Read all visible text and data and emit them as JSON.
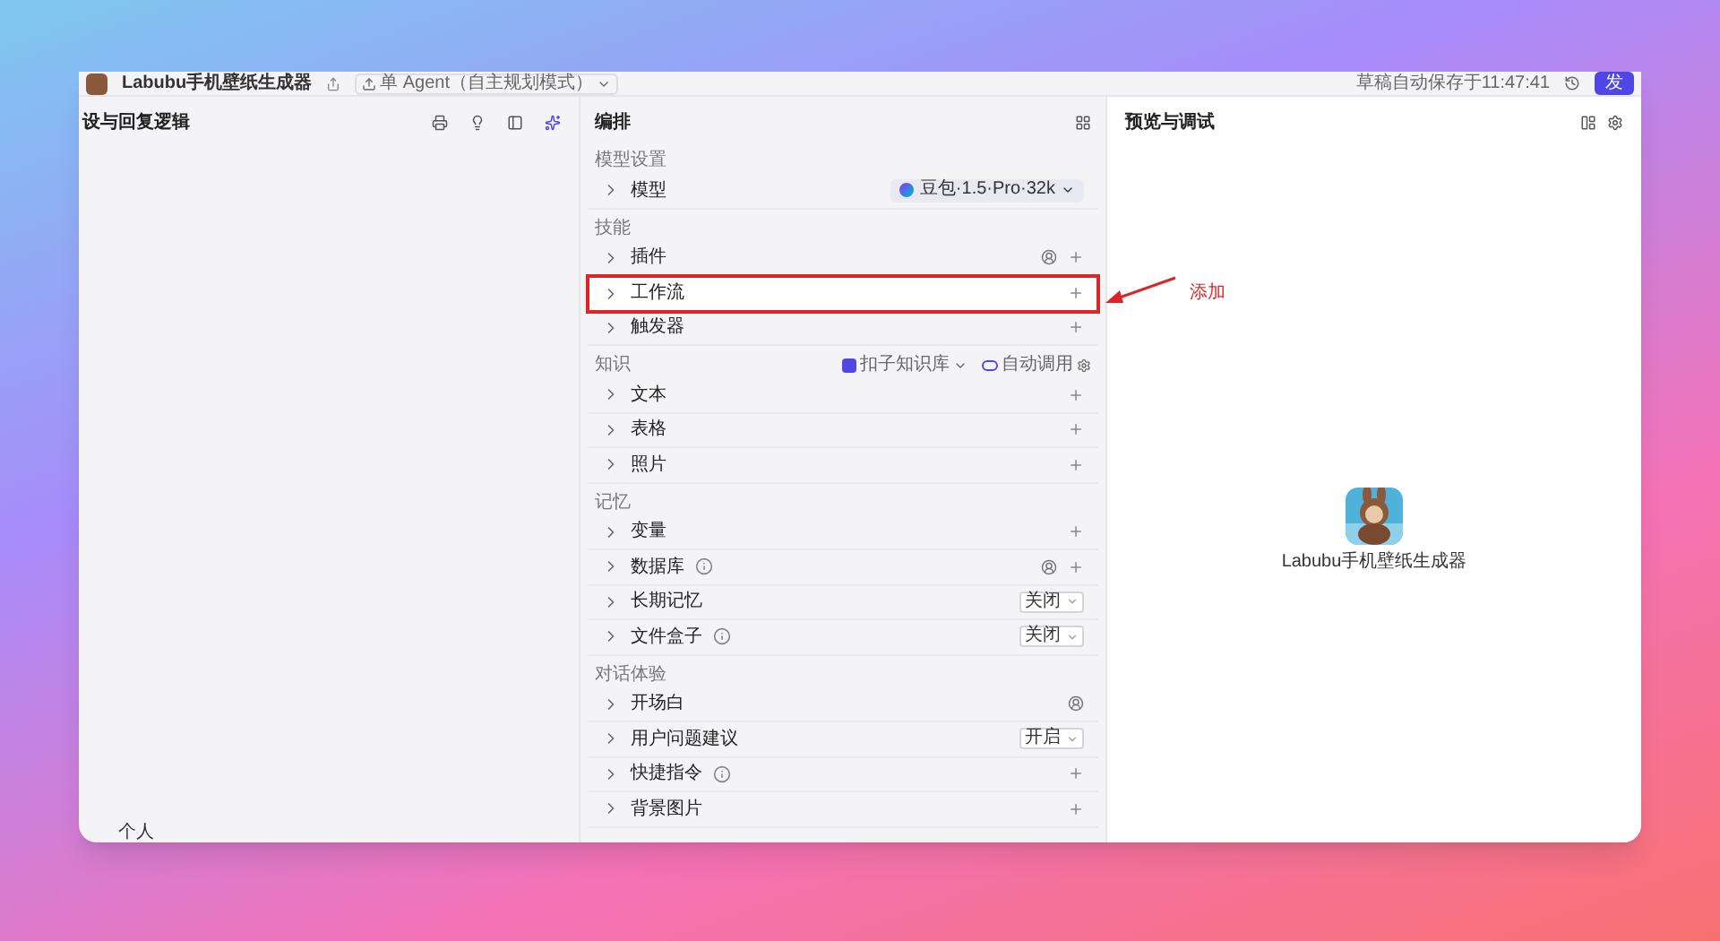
{
  "top_bar": {
    "app_name": "Labubu手机壁纸生成器",
    "mode": "单 Agent（自主规划模式）",
    "save_status": "草稿自动保存于11:47:41",
    "publish": "发"
  },
  "left_panel": {
    "title": "设与回复逻辑",
    "tabs": [
      {
        "label": "个人",
        "selected": false
      }
    ]
  },
  "middle_panel": {
    "title": "编排",
    "sections": [
      {
        "title": "模型设置",
        "rows": [
          {
            "label": "模型",
            "kind": "model",
            "value": "豆包·1.5·Pro·32k",
            "info": false,
            "auto": false,
            "add": false,
            "highlighted": false
          }
        ]
      },
      {
        "title": "技能",
        "rows": [
          {
            "label": "插件",
            "kind": "plain",
            "info": false,
            "auto": true,
            "add": true,
            "highlighted": false
          },
          {
            "label": "工作流",
            "kind": "plain",
            "info": false,
            "auto": false,
            "add": true,
            "highlighted": true
          },
          {
            "label": "触发器",
            "kind": "plain",
            "info": false,
            "auto": false,
            "add": true,
            "highlighted": false
          }
        ]
      },
      {
        "title": "知识",
        "knowledge_base": "扣子知识库",
        "call_mode": "自动调用",
        "rows": [
          {
            "label": "文本",
            "kind": "plain",
            "info": false,
            "auto": false,
            "add": true,
            "highlighted": false
          },
          {
            "label": "表格",
            "kind": "plain",
            "info": false,
            "auto": false,
            "add": true,
            "highlighted": false
          },
          {
            "label": "照片",
            "kind": "plain",
            "info": false,
            "auto": false,
            "add": true,
            "highlighted": false
          }
        ]
      },
      {
        "title": "记忆",
        "rows": [
          {
            "label": "变量",
            "kind": "plain",
            "info": false,
            "auto": false,
            "add": true,
            "highlighted": false
          },
          {
            "label": "数据库",
            "kind": "plain",
            "info": true,
            "auto": true,
            "add": true,
            "highlighted": false
          },
          {
            "label": "长期记忆",
            "kind": "select",
            "value": "关闭",
            "info": false,
            "auto": false,
            "add": false,
            "highlighted": false
          },
          {
            "label": "文件盒子",
            "kind": "select",
            "value": "关闭",
            "info": true,
            "auto": false,
            "add": false,
            "highlighted": false
          }
        ]
      },
      {
        "title": "对话体验",
        "rows": [
          {
            "label": "开场白",
            "kind": "plain",
            "info": false,
            "auto": true,
            "add": false,
            "highlighted": false
          },
          {
            "label": "用户问题建议",
            "kind": "select",
            "value": "开启",
            "info": false,
            "auto": false,
            "add": false,
            "highlighted": false
          },
          {
            "label": "快捷指令",
            "kind": "plain",
            "info": true,
            "auto": false,
            "add": true,
            "highlighted": false
          },
          {
            "label": "背景图片",
            "kind": "plain",
            "info": false,
            "auto": false,
            "add": true,
            "highlighted": false
          }
        ]
      }
    ]
  },
  "right_panel": {
    "title": "预览与调试",
    "bot_name": "Labubu手机壁纸生成器"
  },
  "annotation": {
    "text": "添加"
  }
}
